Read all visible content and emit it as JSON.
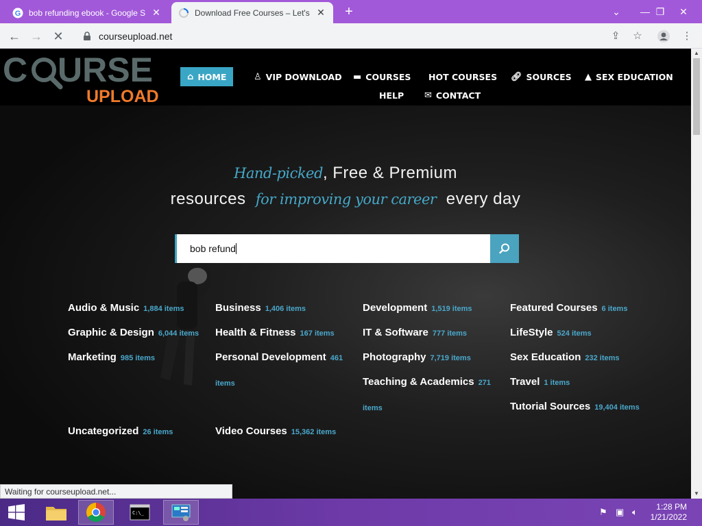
{
  "browser": {
    "tabs": [
      {
        "title": "bob refunding ebook - Google S",
        "active": false
      },
      {
        "title": "Download Free Courses – Let's st",
        "active": true
      }
    ],
    "url": "courseupload.net",
    "status_text": "Waiting for courseupload.net..."
  },
  "site": {
    "logo": {
      "word1": "C",
      "word1b": "URSE",
      "word2": "UPLOAD"
    },
    "nav": [
      {
        "label": "HOME",
        "icon": "home-icon"
      },
      {
        "label": "VIP DOWNLOAD",
        "icon": "user-icon"
      },
      {
        "label": "COURSES",
        "icon": "folder-icon"
      },
      {
        "label": "HOT COURSES",
        "icon": ""
      },
      {
        "label": "SOURCES",
        "icon": "link-icon"
      },
      {
        "label": "SEX EDUCATION",
        "icon": "graduation-cap-icon"
      },
      {
        "label": "HELP",
        "icon": ""
      },
      {
        "label": "CONTACT",
        "icon": "envelope-icon"
      }
    ],
    "hero": {
      "l1_script": "Hand-picked",
      "l1_rest": ", Free & Premium",
      "l2_start": "resources",
      "l2_script": "for improving your career",
      "l2_end": "every day"
    },
    "search": {
      "value": "bob refund"
    },
    "categories": [
      {
        "name": "Audio & Music",
        "count": "1,884 items"
      },
      {
        "name": "Business",
        "count": "1,406 items"
      },
      {
        "name": "Development",
        "count": "1,519 items"
      },
      {
        "name": "Featured Courses",
        "count": "6 items"
      },
      {
        "name": "Graphic & Design",
        "count": "6,044 items"
      },
      {
        "name": "Health & Fitness",
        "count": "167 items"
      },
      {
        "name": "IT & Software",
        "count": "777 items"
      },
      {
        "name": "LifeStyle",
        "count": "524 items"
      },
      {
        "name": "Marketing",
        "count": "985 items"
      },
      {
        "name": "Personal Development",
        "count": "461 items"
      },
      {
        "name": "Photography",
        "count": "7,719 items"
      },
      {
        "name": "Sex Education",
        "count": "232 items"
      },
      {
        "name": "Teaching & Academics",
        "count": "271 items"
      },
      {
        "name": "Travel",
        "count": "1 items"
      },
      {
        "name": "Tutorial Sources",
        "count": "19,404 items"
      },
      {
        "name": "Uncategorized",
        "count": "26 items"
      },
      {
        "name": "Video Courses",
        "count": "15,362 items"
      }
    ]
  },
  "taskbar": {
    "time": "1:28 PM",
    "date": "1/21/2022"
  },
  "colors": {
    "accent": "#3aa6c5",
    "tabstrip": "#a259d9",
    "logo_orange": "#f07a2a",
    "logo_grey": "#5a6a6a"
  }
}
